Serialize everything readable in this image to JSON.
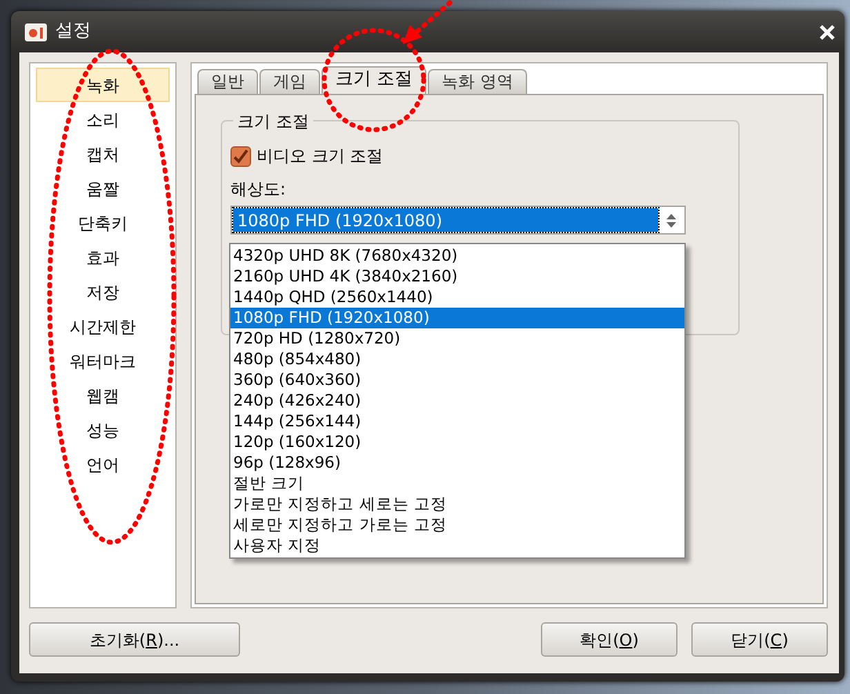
{
  "window": {
    "title": "설정"
  },
  "sidebar": {
    "items": [
      {
        "label": "녹화",
        "selected": true
      },
      {
        "label": "소리",
        "selected": false
      },
      {
        "label": "캡처",
        "selected": false
      },
      {
        "label": "움짤",
        "selected": false
      },
      {
        "label": "단축키",
        "selected": false
      },
      {
        "label": "효과",
        "selected": false
      },
      {
        "label": "저장",
        "selected": false
      },
      {
        "label": "시간제한",
        "selected": false
      },
      {
        "label": "워터마크",
        "selected": false
      },
      {
        "label": "웹캠",
        "selected": false
      },
      {
        "label": "성능",
        "selected": false
      },
      {
        "label": "언어",
        "selected": false
      }
    ]
  },
  "tabs": [
    {
      "label": "일반",
      "selected": false
    },
    {
      "label": "게임",
      "selected": false
    },
    {
      "label": "크기 조절",
      "selected": true
    },
    {
      "label": "녹화 영역",
      "selected": false
    }
  ],
  "group": {
    "title": "크기 조절",
    "checkbox": {
      "label": "비디오 크기 조절",
      "checked": true
    },
    "resolution": {
      "label": "해상도:",
      "value": "1080p FHD (1920x1080)",
      "expanded": true,
      "options": [
        {
          "label": "4320p UHD 8K (7680x4320)",
          "selected": false
        },
        {
          "label": "2160p UHD 4K (3840x2160)",
          "selected": false
        },
        {
          "label": "1440p QHD (2560x1440)",
          "selected": false
        },
        {
          "label": "1080p FHD (1920x1080)",
          "selected": true
        },
        {
          "label": "720p HD (1280x720)",
          "selected": false
        },
        {
          "label": "480p (854x480)",
          "selected": false
        },
        {
          "label": "360p (640x360)",
          "selected": false
        },
        {
          "label": "240p (426x240)",
          "selected": false
        },
        {
          "label": "144p (256x144)",
          "selected": false
        },
        {
          "label": "120p (160x120)",
          "selected": false
        },
        {
          "label": "96p (128x96)",
          "selected": false
        },
        {
          "label": "절반 크기",
          "selected": false
        },
        {
          "label": "가로만 지정하고 세로는 고정",
          "selected": false
        },
        {
          "label": "세로만 지정하고 가로는 고정",
          "selected": false
        },
        {
          "label": "사용자 지정",
          "selected": false
        }
      ]
    }
  },
  "buttons": [
    {
      "before": "초기화(",
      "mnemonic": "R",
      "after": ")...",
      "kind": "left"
    },
    {
      "before": "확인(",
      "mnemonic": "O",
      "after": ")",
      "kind": "right"
    },
    {
      "before": "닫기(",
      "mnemonic": "C",
      "after": ")",
      "kind": "right"
    }
  ]
}
